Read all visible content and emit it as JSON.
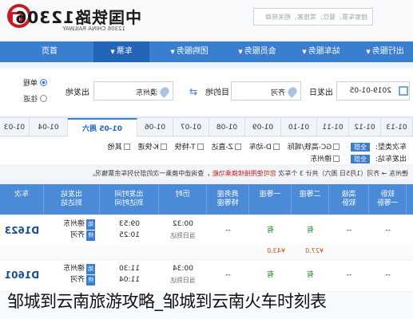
{
  "header": {
    "logo_title": "中国铁路12306",
    "logo_sub": "12306 CHINA RAILWAY",
    "search_placeholder": "搜索车票、餐饮、常旅客、相关规章"
  },
  "nav": {
    "items": [
      {
        "label": "首页",
        "active": false
      },
      {
        "label": "车票",
        "active": true
      },
      {
        "label": "团购服务",
        "active": false
      },
      {
        "label": "会员服务",
        "active": false
      },
      {
        "label": "站车服务",
        "active": false
      },
      {
        "label": "出行服务",
        "active": false
      }
    ]
  },
  "search_form": {
    "trip_type": {
      "one_way": "单程",
      "round_trip": "往返"
    },
    "from_label": "出发地",
    "from_value": "漠州东",
    "to_label": "目的地",
    "to_value": "齐河",
    "date_label": "出发日",
    "date_value": "2019-01-05"
  },
  "dates": {
    "items": [
      "01-03",
      "01-04",
      "01-05 周六",
      "01-06",
      "01-07",
      "01-08",
      "01-09",
      "01-10",
      "01-11",
      "01-12",
      "01-13"
    ],
    "active_index": 2
  },
  "filters": {
    "train_type_label": "车次类型:",
    "all_label": "全部",
    "train_types": [
      "GC-高铁/城际",
      "D-动车",
      "Z-直达",
      "T-特快",
      "K-快速",
      "其他"
    ],
    "station_label": "出发车站:",
    "stations": [
      "德州东"
    ]
  },
  "banner": {
    "prefix": "德州东 → 齐河（1月5日 周六）共计 3 个车次",
    "highlight": "您可使用接续换乘功能",
    "suffix": "，查询途中换乘一次的部分列车余票情况。"
  },
  "table": {
    "headers": [
      "车次",
      "出发站\n到达站",
      "出发时间\n到达时间",
      "历时",
      "商务座\n特等座",
      "一等座",
      "二等座",
      "高级\n软卧",
      "软卧\n一等卧"
    ],
    "rows": [
      {
        "train": "D1623",
        "from_station": "德州东",
        "to_station": "齐河",
        "depart": "09:53",
        "arrive": "10:25",
        "duration": "00:32",
        "duration_note": "当日到达",
        "business": "--",
        "first": "有",
        "second": "有",
        "high_soft": "--",
        "soft": "--"
      },
      {
        "train": "D1601",
        "from_station": "德州东",
        "to_station": "齐河",
        "depart": "11:30",
        "arrive": "11:04",
        "duration": "00:34",
        "duration_note": "当日到达",
        "business": "--",
        "first": "有",
        "second": "有",
        "high_soft": "--",
        "soft": "--"
      }
    ],
    "price_row": {
      "first": "¥43.0",
      "second": "¥27.0"
    }
  },
  "caption": "邹城到云南旅游攻略_邹城到云南火车时刻表",
  "colors": {
    "nav": "#3a7ed0",
    "table_head": "#4a8ad6",
    "logo": "#c91c22",
    "price": "#d9481c"
  }
}
